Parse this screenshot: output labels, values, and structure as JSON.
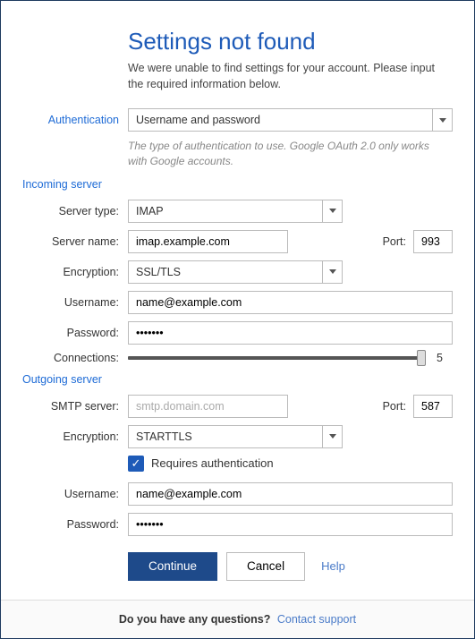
{
  "heading": "Settings not found",
  "subheading": "We were unable to find settings for your account. Please input the required information below.",
  "auth": {
    "label": "Authentication",
    "value": "Username and password",
    "hint": "The type of authentication to use. Google OAuth 2.0 only works with Google accounts."
  },
  "incoming": {
    "section": "Incoming server",
    "server_type_label": "Server type:",
    "server_type_value": "IMAP",
    "server_name_label": "Server name:",
    "server_name_value": "imap.example.com",
    "port_label": "Port:",
    "port_value": "993",
    "encryption_label": "Encryption:",
    "encryption_value": "SSL/TLS",
    "username_label": "Username:",
    "username_value": "name@example.com",
    "password_label": "Password:",
    "password_value": "•••••••",
    "connections_label": "Connections:",
    "connections_value": "5"
  },
  "outgoing": {
    "section": "Outgoing server",
    "smtp_label": "SMTP server:",
    "smtp_placeholder": "smtp.domain.com",
    "smtp_value": "",
    "port_label": "Port:",
    "port_value": "587",
    "encryption_label": "Encryption:",
    "encryption_value": "STARTTLS",
    "requires_auth_label": "Requires authentication",
    "username_label": "Username:",
    "username_value": "name@example.com",
    "password_label": "Password:",
    "password_value": "•••••••"
  },
  "buttons": {
    "continue": "Continue",
    "cancel": "Cancel",
    "help": "Help"
  },
  "footer": {
    "question": "Do you have any questions?",
    "link": "Contact support"
  }
}
